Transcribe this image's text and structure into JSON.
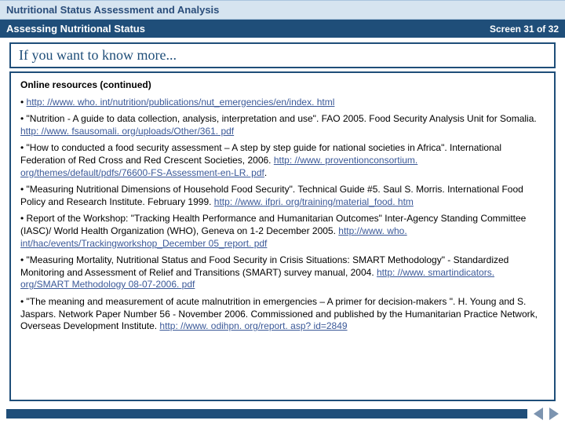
{
  "header": {
    "top": "Nutritional Status Assessment and Analysis",
    "subtitle": "Assessing Nutritional Status",
    "screen": "Screen 31 of 32"
  },
  "section_title": "If you want to know more...",
  "content": {
    "heading": "Online resources (continued)",
    "items": [
      {
        "prefix": "• ",
        "link": "http: //www. who. int/nutrition/publications/nut_emergencies/en/index. html",
        "suffix": ""
      },
      {
        "prefix": "• \"Nutrition - A guide to data collection, analysis, interpretation and use\". FAO 2005.  Food Security Analysis Unit for Somalia. ",
        "link": "http: //www. fsausomali. org/uploads/Other/361. pdf",
        "suffix": ""
      },
      {
        "prefix": "• \"How to conducted a food security assessment – A step by step guide for national societies in Africa\". International Federation of Red Cross and Red Crescent Societies, 2006. ",
        "link": "http: //www. proventionconsortium. org/themes/default/pdfs/76600-FS-Assessment-en-LR. pdf",
        "suffix": "."
      },
      {
        "prefix": "• \"Measuring Nutritional Dimensions of Household Food Security\". Technical Guide #5. Saul S. Morris. International Food Policy and Research Institute. February 1999. ",
        "link": "http: //www. ifpri. org/training/material_food. htm",
        "suffix": ""
      },
      {
        "prefix": "• Report of the Workshop: \"Tracking Health Performance and Humanitarian Outcomes\" Inter-Agency Standing Committee (IASC)/ World Health Organization (WHO), Geneva on 1-2 December 2005. ",
        "link": "http://www. who. int/hac/events/Trackingworkshop_December 05_report. pdf",
        "suffix": ""
      },
      {
        "prefix": "• \"Measuring Mortality, Nutritional Status and Food Security in Crisis Situations: SMART Methodology\" -  Standardized Monitoring and Assessment of Relief and Transitions (SMART) survey manual, 2004.  ",
        "link": "http: //www. smartindicators. org/SMART Methodology 08-07-2006. pdf",
        "suffix": ""
      },
      {
        "prefix": "• \"The meaning and measurement of acute malnutrition in emergencies – A primer for decision-makers \". H. Young and S. Jaspars. Network Paper Number 56 - November 2006. Commissioned and published by the Humanitarian Practice Network, Overseas Development Institute. ",
        "link": "http: //www. odihpn. org/report. asp? id=2849",
        "suffix": ""
      }
    ]
  }
}
